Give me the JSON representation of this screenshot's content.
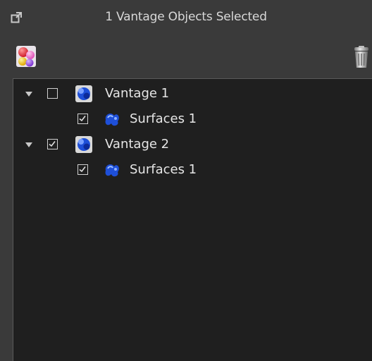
{
  "window": {
    "title": "1 Vantage Objects Selected"
  },
  "icons": {
    "popout": "popout-icon",
    "palette": "palette-icon",
    "trash": "trash-icon",
    "vantage": "vantage-icon",
    "surfaces": "surfaces-icon"
  },
  "tree": [
    {
      "label": "Vantage 1",
      "checked": false,
      "expanded": true,
      "children": [
        {
          "label": "Surfaces 1",
          "checked": true
        }
      ]
    },
    {
      "label": "Vantage 2",
      "checked": true,
      "expanded": true,
      "children": [
        {
          "label": "Surfaces 1",
          "checked": true
        }
      ]
    }
  ],
  "colors": {
    "background": "#3a3a3a",
    "tree_background": "#1f1f1f",
    "text": "#e6e6e6",
    "icon_blue": "#1e4fd8"
  }
}
